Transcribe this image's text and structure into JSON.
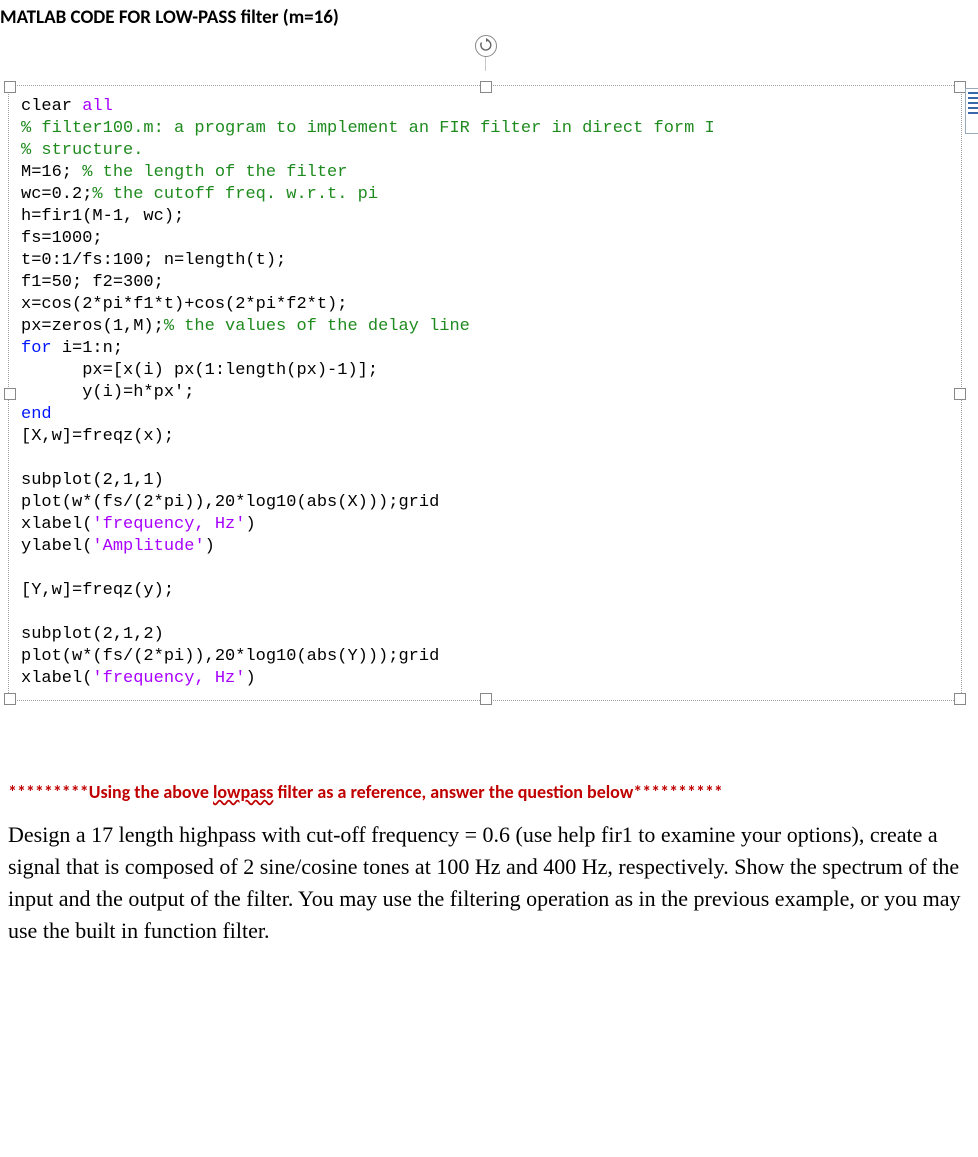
{
  "title": "MATLAB CODE FOR LOW-PASS filter (m=16)",
  "code": {
    "l1a": "clear ",
    "l1b": "all",
    "l2": "% filter100.m: a program to implement an FIR filter in direct form I",
    "l3": "% structure.",
    "l4a": "M=16; ",
    "l4b": "% the length of the filter",
    "l5a": "wc=0.2;",
    "l5b": "% the cutoff freq. w.r.t. pi",
    "l6": "h=fir1(M-1, wc);",
    "l7": "fs=1000;",
    "l8": "t=0:1/fs:100; n=length(t);",
    "l9": "f1=50; f2=300;",
    "l10": "x=cos(2*pi*f1*t)+cos(2*pi*f2*t);",
    "l11a": "px=zeros(1,M);",
    "l11b": "% the values of the delay line",
    "l12a": "for ",
    "l12b": "i=1:n;",
    "l13": "      px=[x(i) px(1:length(px)-1)];",
    "l14": "      y(i)=h*px';",
    "l15": "end",
    "l16": "[X,w]=freqz(x);",
    "l17": "",
    "l18": "subplot(2,1,1)",
    "l19": "plot(w*(fs/(2*pi)),20*log10(abs(X)));grid",
    "l20a": "xlabel(",
    "l20b": "'frequency, Hz'",
    "l20c": ")",
    "l21a": "ylabel(",
    "l21b": "'Amplitude'",
    "l21c": ")",
    "l22": "",
    "l23": "[Y,w]=freqz(y);",
    "l24": "",
    "l25": "subplot(2,1,2)",
    "l26": "plot(w*(fs/(2*pi)),20*log10(abs(Y)));grid",
    "l27a": "xlabel(",
    "l27b": "'frequency, Hz'",
    "l27c": ")"
  },
  "note_prefix": "*********",
  "note_mid1": "Using the above ",
  "note_wavy": "lowpass",
  "note_mid2": " filter as a reference, answer the question below",
  "note_suffix": "**********",
  "question": "Design a 17 length highpass with cut-off frequency = 0.6 (use help fir1 to examine your options), create a signal that is composed of 2 sine/cosine tones at 100 Hz and 400 Hz, respectively. Show the spectrum of the input and the output of the filter. You may use the filtering operation as in the previous example, or you may use the built in function filter."
}
